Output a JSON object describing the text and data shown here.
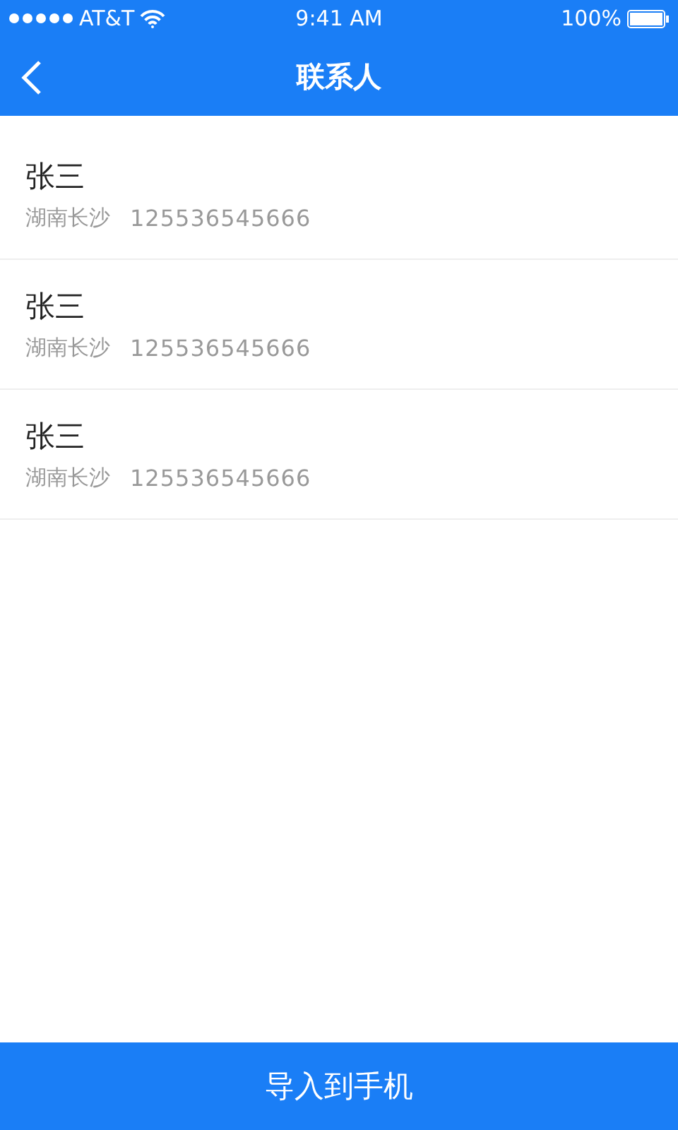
{
  "status_bar": {
    "carrier": "AT&T",
    "time": "9:41 AM",
    "battery": "100%"
  },
  "nav": {
    "title": "联系人"
  },
  "contacts": [
    {
      "name": "张三",
      "region": "湖南长沙",
      "phone": "125536545666"
    },
    {
      "name": "张三",
      "region": "湖南长沙",
      "phone": "125536545666"
    },
    {
      "name": "张三",
      "region": "湖南长沙",
      "phone": "125536545666"
    }
  ],
  "action": {
    "label": "导入到手机"
  }
}
